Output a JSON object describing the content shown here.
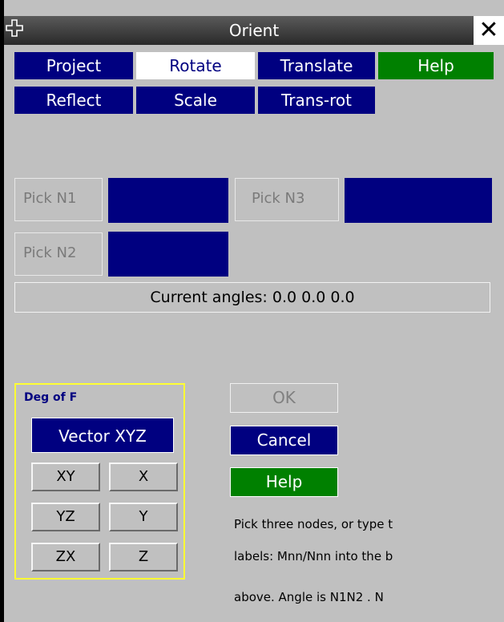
{
  "window": {
    "title": "Orient",
    "close_symbol": "✕"
  },
  "tabs": [
    {
      "label": "Project"
    },
    {
      "label": "Rotate"
    },
    {
      "label": "Translate"
    },
    {
      "label": "Help"
    },
    {
      "label": "Reflect"
    },
    {
      "label": "Scale"
    },
    {
      "label": "Trans-rot"
    }
  ],
  "picks": {
    "n1_label": "Pick N1",
    "n2_label": "Pick N2",
    "n3_label": "Pick N3"
  },
  "current_angles": "Current angles:  0.0  0.0  0.0",
  "dof": {
    "title": "Deg of F",
    "vector_label": "Vector XYZ",
    "buttons": [
      "XY",
      "X",
      "YZ",
      "Y",
      "ZX",
      "Z"
    ]
  },
  "actions": {
    "ok": "OK",
    "cancel": "Cancel",
    "help": "Help"
  },
  "hint_lines": [
    "Pick three nodes, or type t",
    "labels: Mnn/Nnn into the b",
    "above.  Angle is N1N2 . N"
  ],
  "colors": {
    "navy": "#000080",
    "help_green": "#008000",
    "panel_grey": "#c0c0c0",
    "dof_border": "#ffff33"
  },
  "icons": {
    "move": "four-way-arrow-icon",
    "close": "close-icon"
  }
}
